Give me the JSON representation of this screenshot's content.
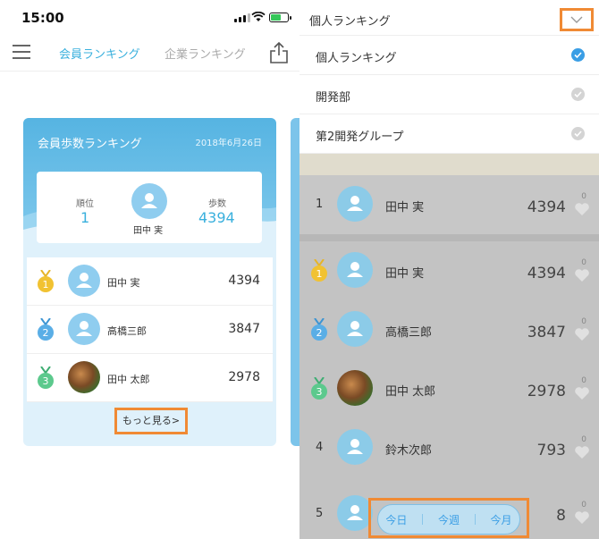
{
  "status_bar": {
    "time": "15:00"
  },
  "nav": {
    "tabs": [
      "会員ランキング",
      "企業ランキング"
    ]
  },
  "card": {
    "title": "会員歩数ランキング",
    "date": "2018年6月26日",
    "summary": {
      "rank_label": "順位",
      "rank_value": "1",
      "steps_label": "歩数",
      "steps_value": "4394",
      "name": "田中 実"
    },
    "rows": [
      {
        "medal": "1",
        "name": "田中 実",
        "value": "4394"
      },
      {
        "medal": "2",
        "name": "高橋三郎",
        "value": "3847"
      },
      {
        "medal": "3",
        "name": "田中 太郎",
        "value": "2978"
      }
    ],
    "more_label": "もっと見る>"
  },
  "dropdown": {
    "title": "個人ランキング",
    "items": [
      {
        "label": "個人ランキング",
        "selected": true
      },
      {
        "label": "開発部",
        "selected": false
      },
      {
        "label": "第2開発グループ",
        "selected": false
      }
    ]
  },
  "ranking": {
    "my_row": {
      "rank": "1",
      "name": "田中 実",
      "value": "4394",
      "likes": "0"
    },
    "rows": [
      {
        "rank": "1",
        "medal": true,
        "name": "田中 実",
        "value": "4394",
        "likes": "0"
      },
      {
        "rank": "2",
        "medal": true,
        "name": "高橋三郎",
        "value": "3847",
        "likes": "0"
      },
      {
        "rank": "3",
        "medal": true,
        "name": "田中 太郎",
        "value": "2978",
        "likes": "0"
      },
      {
        "rank": "4",
        "medal": false,
        "name": "鈴木次郎",
        "value": "793",
        "likes": "0"
      },
      {
        "rank": "5",
        "medal": false,
        "name": "",
        "value": "8",
        "likes": "0"
      }
    ]
  },
  "period": {
    "options": [
      "今日",
      "今週",
      "今月"
    ]
  },
  "colors": {
    "accent": "#3ab0dd",
    "highlight": "#f08a34",
    "gold": "#f1c232",
    "silver_blue": "#5aaee6",
    "bronze_green": "#5cc98d"
  }
}
